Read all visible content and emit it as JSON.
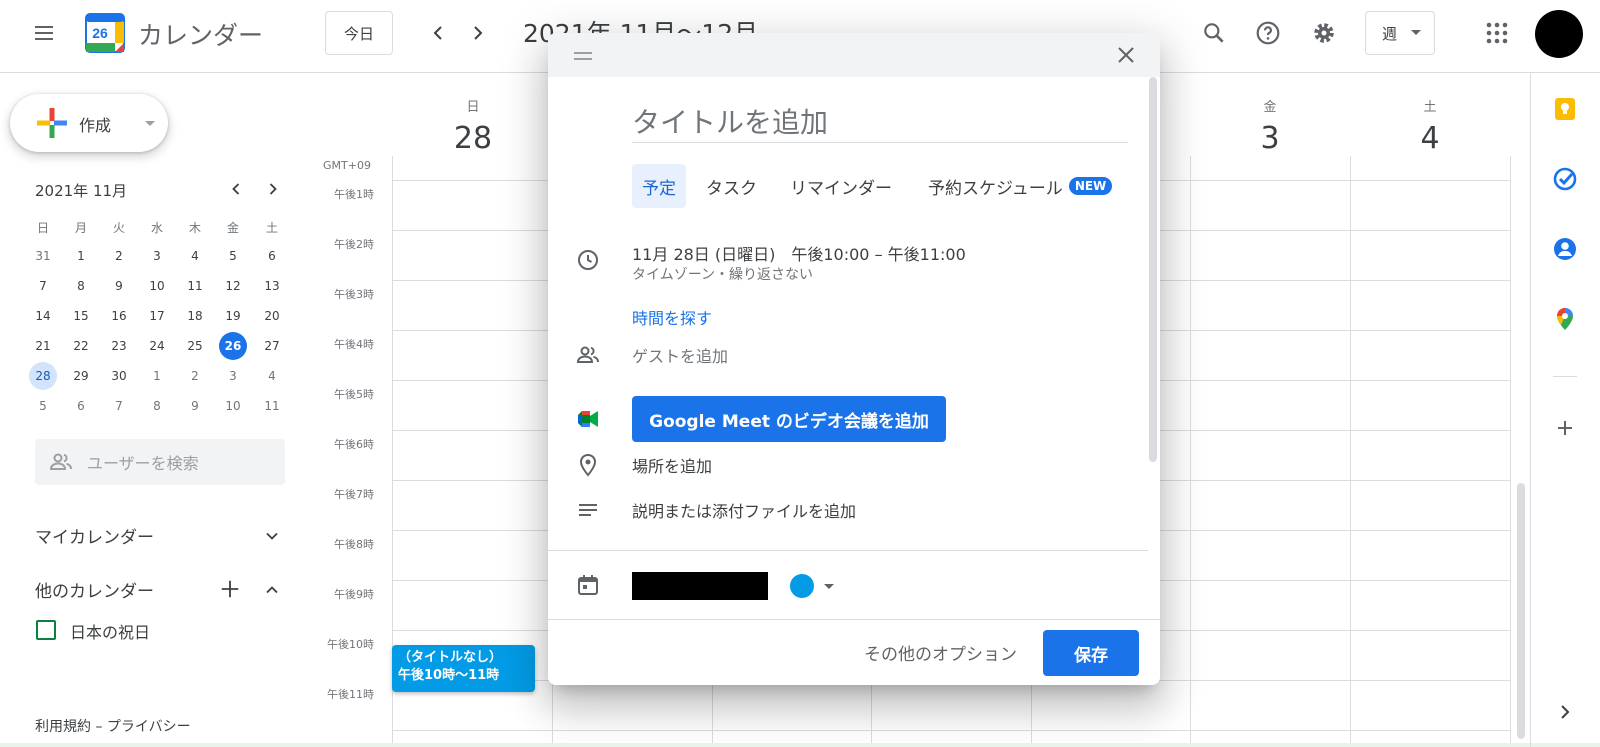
{
  "header": {
    "app_title": "カレンダー",
    "logo_day": "26",
    "today_label": "今日",
    "date_range": "2021年 11月～12月",
    "view_label": "週"
  },
  "sidebar": {
    "create_label": "作成",
    "mini_month": "2021年 11月",
    "weekdays": [
      "日",
      "月",
      "火",
      "水",
      "木",
      "金",
      "土"
    ],
    "weeks": [
      [
        "31",
        "1",
        "2",
        "3",
        "4",
        "5",
        "6"
      ],
      [
        "7",
        "8",
        "9",
        "10",
        "11",
        "12",
        "13"
      ],
      [
        "14",
        "15",
        "16",
        "17",
        "18",
        "19",
        "20"
      ],
      [
        "21",
        "22",
        "23",
        "24",
        "25",
        "26",
        "27"
      ],
      [
        "28",
        "29",
        "30",
        "1",
        "2",
        "3",
        "4"
      ],
      [
        "5",
        "6",
        "7",
        "8",
        "9",
        "10",
        "11"
      ]
    ],
    "search_placeholder": "ユーザーを検索",
    "my_calendars": "マイカレンダー",
    "other_calendars": "他のカレンダー",
    "holiday_calendar": "日本の祝日",
    "footer": "利用規約 – プライバシー"
  },
  "grid": {
    "timezone": "GMT+09",
    "days": [
      {
        "weekday": "日",
        "date": "28"
      },
      {
        "weekday": "金",
        "date": "3"
      },
      {
        "weekday": "土",
        "date": "4"
      }
    ],
    "hours": [
      "午後1時",
      "午後2時",
      "午後3時",
      "午後4時",
      "午後5時",
      "午後6時",
      "午後7時",
      "午後8時",
      "午後9時",
      "午後10時",
      "午後11時"
    ],
    "event": {
      "title": "（タイトルなし）",
      "time": "午後10時～11時",
      "color": "#039be5"
    }
  },
  "dialog": {
    "title_placeholder": "タイトルを追加",
    "tabs": [
      "予定",
      "タスク",
      "リマインダー",
      "予約スケジュール"
    ],
    "new_badge": "NEW",
    "datetime": "11月 28日 (日曜日)　午後10:00 – 午後11:00",
    "timezone_repeat": "タイムゾーン・繰り返さない",
    "find_time": "時間を探す",
    "add_guests": "ゲストを追加",
    "meet_button": "Google Meet のビデオ会議を追加",
    "add_location": "場所を追加",
    "add_description": "説明または添付ファイルを追加",
    "more_options": "その他のオプション",
    "save": "保存"
  },
  "colors": {
    "primary": "#1a73e8",
    "event": "#039be5",
    "holiday": "#0b8043"
  }
}
